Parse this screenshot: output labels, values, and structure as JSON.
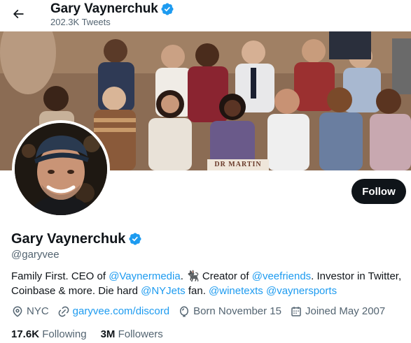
{
  "header": {
    "name": "Gary Vaynerchuk",
    "tweet_count": "202.3K Tweets",
    "back_icon": "arrow-left-icon",
    "verified_icon": "verified-badge-icon"
  },
  "banner": {
    "sign_text": "DR MARTIN"
  },
  "profile": {
    "follow_label": "Follow",
    "display_name": "Gary Vaynerchuk",
    "handle": "@garyvee",
    "bio": {
      "p1": "Family First. CEO of ",
      "link_vaynermedia": "@Vaynermedia",
      "p2": ". 🐈‍⬛ Creator of ",
      "link_veefriends": "@veefriends",
      "p3": ". Investor in Twitter, Coinbase & more. Die hard ",
      "link_nyjets": "@NYJets",
      "p4": " fan. ",
      "link_winetexts": "@winetexts",
      "p5": " ",
      "link_vaynersports": "@vaynersports"
    },
    "meta": {
      "location": "NYC",
      "website": "garyvee.com/discord",
      "birthday": "Born November 15",
      "joined": "Joined May 2007"
    },
    "stats": {
      "following_count": "17.6K",
      "following_label": "Following",
      "followers_count": "3M",
      "followers_label": "Followers"
    }
  },
  "colors": {
    "accent": "#1d9bf0",
    "text": "#0f1419",
    "muted": "#536471",
    "button_bg": "#0f1419"
  }
}
